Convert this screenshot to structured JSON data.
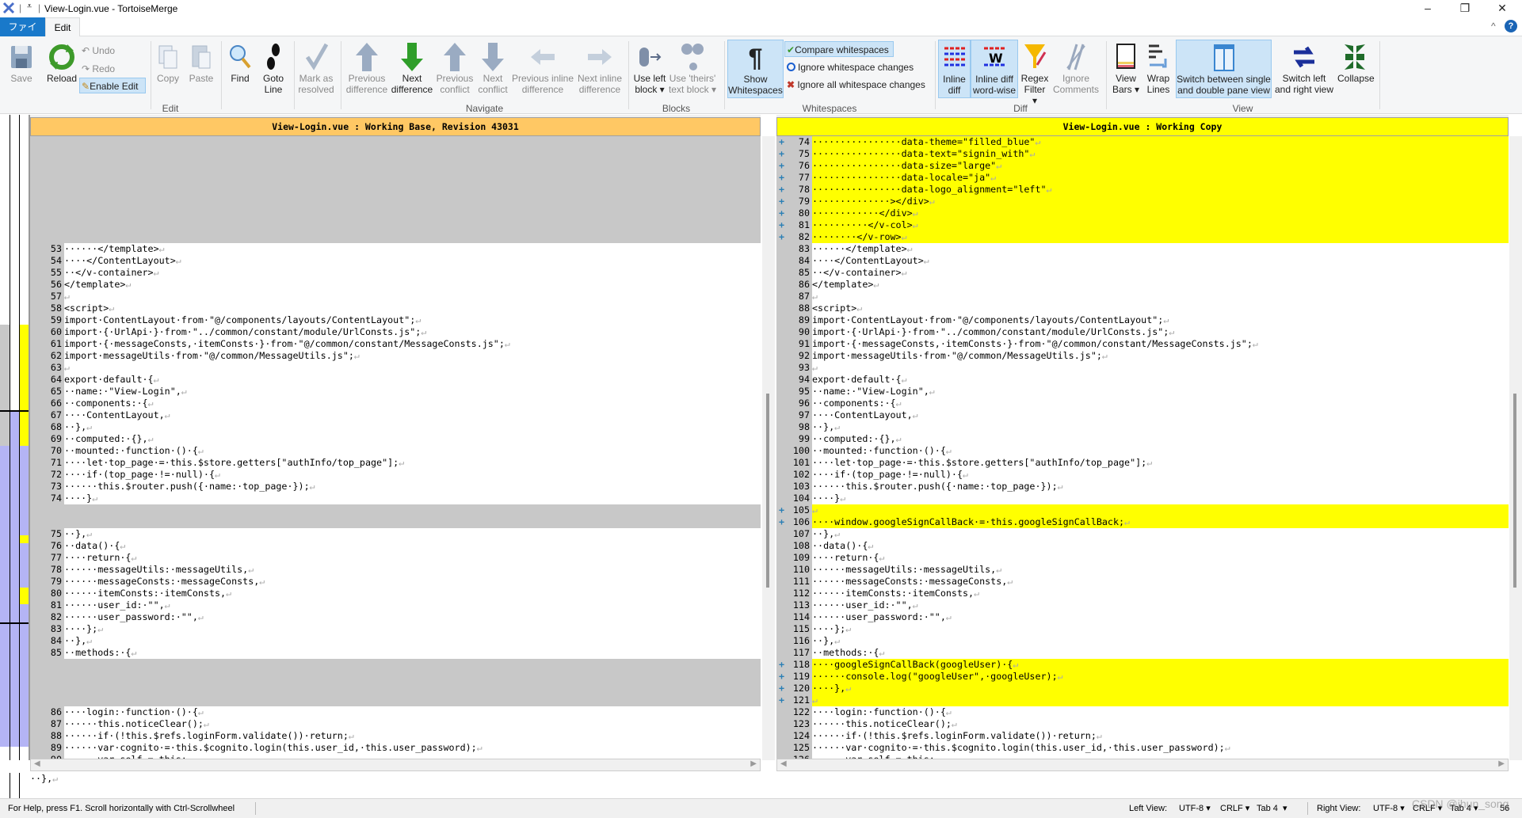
{
  "window": {
    "title": "View-Login.vue - TortoiseMerge",
    "minimize": "–",
    "maximize": "❐",
    "close": "✕",
    "collapse_ribbon": "^",
    "help": "?"
  },
  "tabs": [
    {
      "label": "ファイル",
      "active": false
    },
    {
      "label": "Edit",
      "active": true
    }
  ],
  "ribbon": {
    "groups": {
      "edit": "Edit",
      "navigate": "Navigate",
      "blocks": "Blocks",
      "whitespaces": "Whitespaces",
      "diff": "Diff",
      "view": "View"
    },
    "buttons": {
      "save": "Save",
      "reload": "Reload",
      "undo": "Undo",
      "redo": "Redo",
      "enable_edit": "Enable Edit",
      "copy": "Copy",
      "paste": "Paste",
      "find": "Find",
      "goto_line": [
        "Goto",
        "Line"
      ],
      "mark_resolved": [
        "Mark as",
        "resolved"
      ],
      "prev_diff": [
        "Previous",
        "difference"
      ],
      "next_diff": [
        "Next",
        "difference"
      ],
      "prev_conflict": [
        "Previous",
        "conflict"
      ],
      "next_conflict": [
        "Next",
        "conflict"
      ],
      "prev_inline": [
        "Previous inline",
        "difference"
      ],
      "next_inline": [
        "Next inline",
        "difference"
      ],
      "use_left": [
        "Use left",
        "block ▾"
      ],
      "use_theirs": [
        "Use 'theirs'",
        "text block ▾"
      ],
      "show_ws": [
        "Show",
        "Whitespaces"
      ],
      "compare_ws": "Compare whitespaces",
      "ignore_ws_changes": "Ignore whitespace changes",
      "ignore_all_ws": "Ignore all whitespace changes",
      "inline_diff": [
        "Inline",
        "diff"
      ],
      "inline_word": [
        "Inline diff",
        "word-wise"
      ],
      "regex": [
        "Regex",
        "Filter ▾"
      ],
      "ignore_comments": [
        "Ignore",
        "Comments"
      ],
      "view_bars": [
        "View",
        "Bars ▾"
      ],
      "wrap_lines": [
        "Wrap",
        "Lines"
      ],
      "switch_pane": [
        "Switch between single",
        "and double pane view"
      ],
      "switch_lr": [
        "Switch left",
        "and right view"
      ],
      "collapse": "Collapse"
    }
  },
  "left_pane": {
    "header": "View-Login.vue : Working Base, Revision 43031",
    "rows": [
      {
        "gap": true
      },
      {
        "gap": true
      },
      {
        "gap": true
      },
      {
        "gap": true
      },
      {
        "gap": true
      },
      {
        "gap": true
      },
      {
        "gap": true
      },
      {
        "gap": true
      },
      {
        "gap": true
      },
      {
        "n": "53",
        "text": "······</template>"
      },
      {
        "n": "54",
        "text": "····</ContentLayout>"
      },
      {
        "n": "55",
        "text": "··</v-container>"
      },
      {
        "n": "56",
        "text": "</template>"
      },
      {
        "n": "57",
        "text": ""
      },
      {
        "n": "58",
        "text": "<script>"
      },
      {
        "n": "59",
        "text": "import·ContentLayout·from·\"@/components/layouts/ContentLayout\";"
      },
      {
        "n": "60",
        "text": "import·{·UrlApi·}·from·\"../common/constant/module/UrlConsts.js\";"
      },
      {
        "n": "61",
        "text": "import·{·messageConsts,·itemConsts·}·from·\"@/common/constant/MessageConsts.js\";"
      },
      {
        "n": "62",
        "text": "import·messageUtils·from·\"@/common/MessageUtils.js\";"
      },
      {
        "n": "63",
        "text": ""
      },
      {
        "n": "64",
        "text": "export·default·{"
      },
      {
        "n": "65",
        "text": "··name:·\"View-Login\","
      },
      {
        "n": "66",
        "text": "··components:·{"
      },
      {
        "n": "67",
        "text": "····ContentLayout,"
      },
      {
        "n": "68",
        "text": "··},"
      },
      {
        "n": "69",
        "text": "··computed:·{},"
      },
      {
        "n": "70",
        "text": "··mounted:·function·()·{"
      },
      {
        "n": "71",
        "text": "····let·top_page·=·this.$store.getters[\"authInfo/top_page\"];"
      },
      {
        "n": "72",
        "text": "····if·(top_page·!=·null)·{"
      },
      {
        "n": "73",
        "text": "······this.$router.push({·name:·top_page·});"
      },
      {
        "n": "74",
        "text": "····}"
      },
      {
        "gap": true
      },
      {
        "gap": true
      },
      {
        "n": "75",
        "text": "··},"
      },
      {
        "n": "76",
        "text": "··data()·{"
      },
      {
        "n": "77",
        "text": "····return·{"
      },
      {
        "n": "78",
        "text": "······messageUtils:·messageUtils,"
      },
      {
        "n": "79",
        "text": "······messageConsts:·messageConsts,"
      },
      {
        "n": "80",
        "text": "······itemConsts:·itemConsts,"
      },
      {
        "n": "81",
        "text": "······user_id:·\"\","
      },
      {
        "n": "82",
        "text": "······user_password:·\"\","
      },
      {
        "n": "83",
        "text": "····};"
      },
      {
        "n": "84",
        "text": "··},"
      },
      {
        "n": "85",
        "text": "··methods:·{"
      },
      {
        "gap": true
      },
      {
        "gap": true
      },
      {
        "gap": true
      },
      {
        "gap": true
      },
      {
        "n": "86",
        "text": "····login:·function·()·{"
      },
      {
        "n": "87",
        "text": "······this.noticeClear();"
      },
      {
        "n": "88",
        "text": "······if·(!this.$refs.loginForm.validate())·return;"
      },
      {
        "n": "89",
        "text": "······var·cognito·=·this.$cognito.login(this.user_id,·this.user_password);"
      },
      {
        "n": "90",
        "text": "······var·self·=·this;"
      }
    ]
  },
  "right_pane": {
    "header": "View-Login.vue : Working Copy",
    "added_marker": "+",
    "rows": [
      {
        "n": "74",
        "text": "················data-theme=\"filled_blue\"",
        "added": true
      },
      {
        "n": "75",
        "text": "················data-text=\"signin_with\"",
        "added": true
      },
      {
        "n": "76",
        "text": "················data-size=\"large\"",
        "added": true
      },
      {
        "n": "77",
        "text": "················data-locale=\"ja\"",
        "added": true
      },
      {
        "n": "78",
        "text": "················data-logo_alignment=\"left\"",
        "added": true
      },
      {
        "n": "79",
        "text": "··············></div>",
        "added": true
      },
      {
        "n": "80",
        "text": "············</div>",
        "added": true
      },
      {
        "n": "81",
        "text": "··········</v-col>",
        "added": true
      },
      {
        "n": "82",
        "text": "········</v-row>",
        "added": true
      },
      {
        "n": "83",
        "text": "······</template>"
      },
      {
        "n": "84",
        "text": "····</ContentLayout>"
      },
      {
        "n": "85",
        "text": "··</v-container>"
      },
      {
        "n": "86",
        "text": "</template>"
      },
      {
        "n": "87",
        "text": ""
      },
      {
        "n": "88",
        "text": "<script>"
      },
      {
        "n": "89",
        "text": "import·ContentLayout·from·\"@/components/layouts/ContentLayout\";"
      },
      {
        "n": "90",
        "text": "import·{·UrlApi·}·from·\"../common/constant/module/UrlConsts.js\";"
      },
      {
        "n": "91",
        "text": "import·{·messageConsts,·itemConsts·}·from·\"@/common/constant/MessageConsts.js\";"
      },
      {
        "n": "92",
        "text": "import·messageUtils·from·\"@/common/MessageUtils.js\";"
      },
      {
        "n": "93",
        "text": ""
      },
      {
        "n": "94",
        "text": "export·default·{"
      },
      {
        "n": "95",
        "text": "··name:·\"View-Login\","
      },
      {
        "n": "96",
        "text": "··components:·{"
      },
      {
        "n": "97",
        "text": "····ContentLayout,"
      },
      {
        "n": "98",
        "text": "··},"
      },
      {
        "n": "99",
        "text": "··computed:·{},"
      },
      {
        "n": "100",
        "text": "··mounted:·function·()·{"
      },
      {
        "n": "101",
        "text": "····let·top_page·=·this.$store.getters[\"authInfo/top_page\"];"
      },
      {
        "n": "102",
        "text": "····if·(top_page·!=·null)·{"
      },
      {
        "n": "103",
        "text": "······this.$router.push({·name:·top_page·});"
      },
      {
        "n": "104",
        "text": "····}"
      },
      {
        "n": "105",
        "text": "",
        "added": true
      },
      {
        "n": "106",
        "text": "····window.googleSignCallBack·=·this.googleSignCallBack;",
        "added": true
      },
      {
        "n": "107",
        "text": "··},"
      },
      {
        "n": "108",
        "text": "··data()·{"
      },
      {
        "n": "109",
        "text": "····return·{"
      },
      {
        "n": "110",
        "text": "······messageUtils:·messageUtils,"
      },
      {
        "n": "111",
        "text": "······messageConsts:·messageConsts,"
      },
      {
        "n": "112",
        "text": "······itemConsts:·itemConsts,"
      },
      {
        "n": "113",
        "text": "······user_id:·\"\","
      },
      {
        "n": "114",
        "text": "······user_password:·\"\","
      },
      {
        "n": "115",
        "text": "····};"
      },
      {
        "n": "116",
        "text": "··},"
      },
      {
        "n": "117",
        "text": "··methods:·{"
      },
      {
        "n": "118",
        "text": "····googleSignCallBack(googleUser)·{",
        "added": true
      },
      {
        "n": "119",
        "text": "······console.log(\"googleUser\",·googleUser);",
        "added": true
      },
      {
        "n": "120",
        "text": "····},",
        "added": true
      },
      {
        "n": "121",
        "text": "",
        "added": true
      },
      {
        "n": "122",
        "text": "····login:·function·()·{"
      },
      {
        "n": "123",
        "text": "······this.noticeClear();"
      },
      {
        "n": "124",
        "text": "······if·(!this.$refs.loginForm.validate())·return;"
      },
      {
        "n": "125",
        "text": "······var·cognito·=·this.$cognito.login(this.user_id,·this.user_password);"
      },
      {
        "n": "126",
        "text": "······var·self·=·this;"
      }
    ]
  },
  "detail_bar": {
    "left_line": "··},",
    "right_line": "··},"
  },
  "status": {
    "help": "For Help, press F1. Scroll horizontally with Ctrl-Scrollwheel",
    "left_view_label": "Left View:",
    "left_encoding": "UTF-8",
    "left_eol": "CRLF",
    "left_tab": "Tab 4",
    "right_view_label": "Right View:",
    "right_encoding": "UTF-8",
    "right_eol": "CRLF",
    "right_tab": "Tab 4",
    "position": "56",
    "watermark": "CSDN @ihun_song"
  },
  "colors": {
    "left_header": "#ffc864",
    "right_header": "#ffff00",
    "added_line": "#ffff00",
    "gap": "#c8c8c8",
    "locator_changed": "#b4b4f5",
    "file_tab": "#1979ca"
  }
}
